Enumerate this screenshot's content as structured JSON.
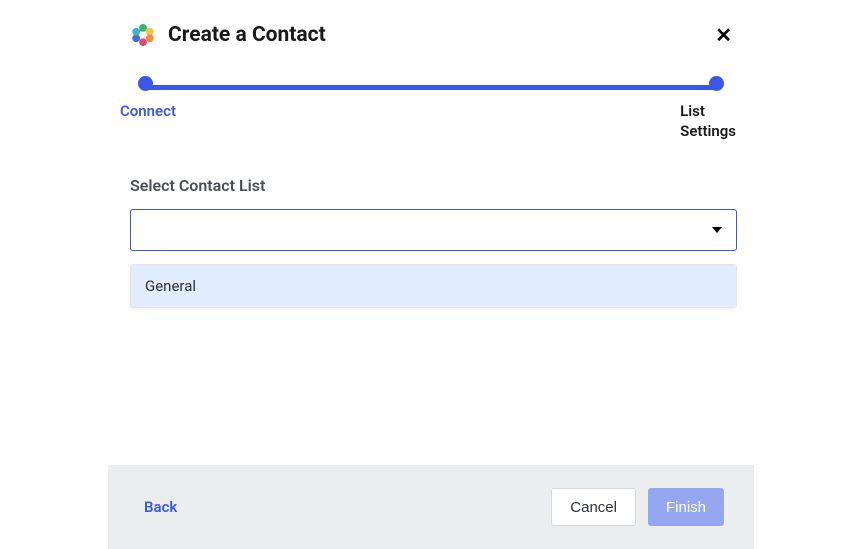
{
  "header": {
    "title": "Create a Contact"
  },
  "stepper": {
    "step1_label": "Connect",
    "step2_label": "List\nSettings"
  },
  "form": {
    "contact_list_label": "Select Contact List",
    "select_value": "",
    "options": [
      {
        "label": "General"
      }
    ]
  },
  "footer": {
    "back_label": "Back",
    "cancel_label": "Cancel",
    "finish_label": "Finish"
  }
}
